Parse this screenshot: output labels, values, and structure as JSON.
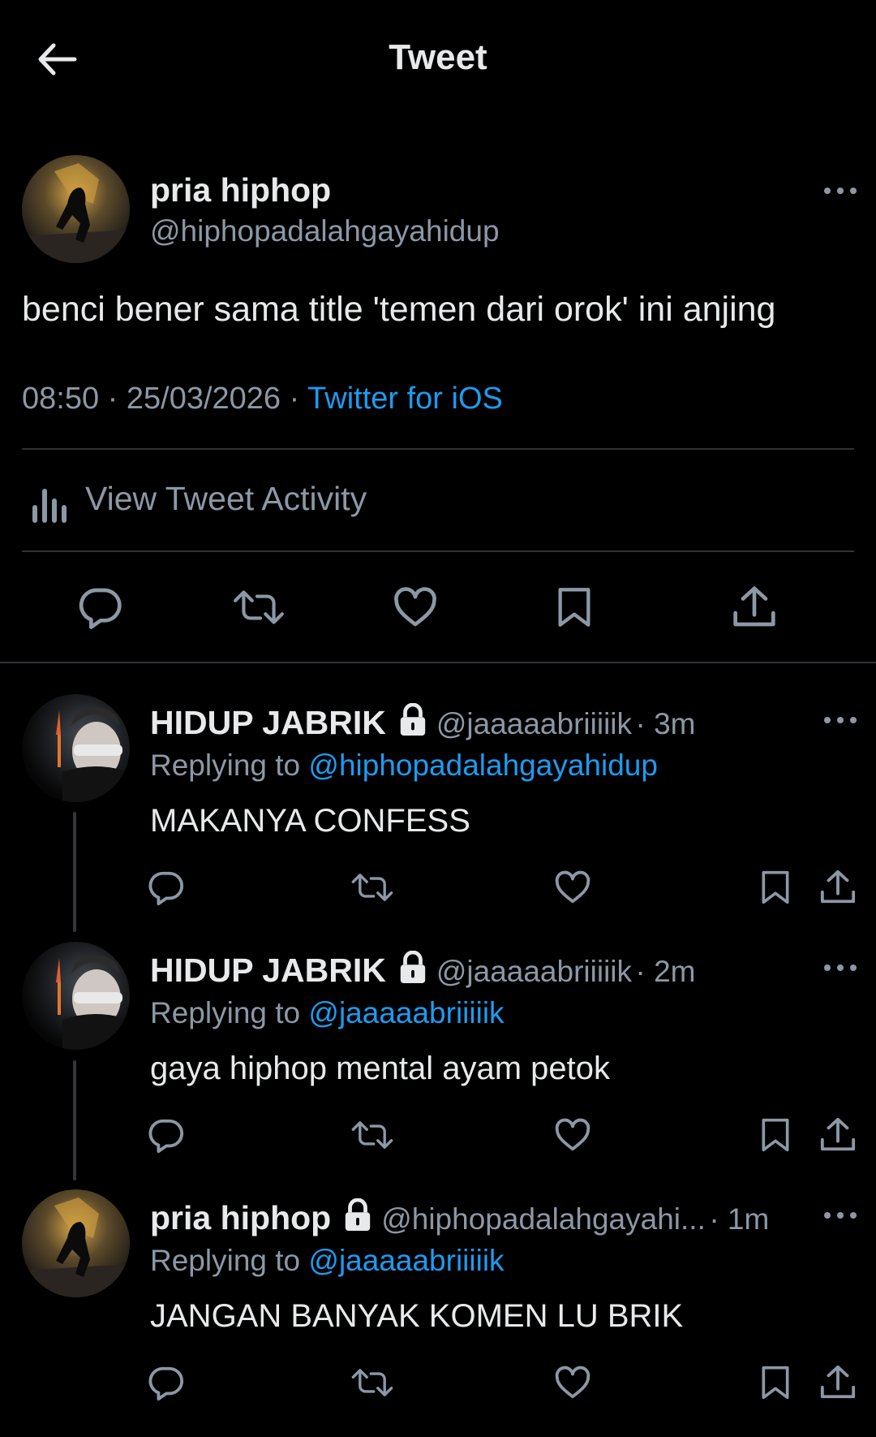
{
  "header": {
    "title": "Tweet"
  },
  "main_tweet": {
    "name": "pria hiphop",
    "handle": "@hiphopadalahgayahidup",
    "text": "benci bener sama title 'temen dari orok' ini anjing",
    "time": "08:50",
    "date": "25/03/2026",
    "source": "Twitter for iOS",
    "separator": "·",
    "activity_label": "View Tweet Activity"
  },
  "replies": [
    {
      "name": "HIDUP JABRIK",
      "handle": "@jaaaaabriiiiik",
      "age": "· 3m",
      "replying_prefix": "Replying to",
      "replying_to": "@hiphopadalahgayahidup",
      "text": "MAKANYA CONFESS"
    },
    {
      "name": "HIDUP JABRIK",
      "handle": "@jaaaaabriiiiik",
      "age": "· 2m",
      "replying_prefix": "Replying to",
      "replying_to": "@jaaaaabriiiiik",
      "text": "gaya hiphop mental ayam petok"
    },
    {
      "name": "pria hiphop",
      "handle": "@hiphopadalahgayahi...",
      "age": "· 1m",
      "replying_prefix": "Replying to",
      "replying_to": "@jaaaaabriiiiik",
      "text": "JANGAN BANYAK KOMEN LU BRIK"
    }
  ],
  "colors": {
    "background": "#000000",
    "text": "#e7e9ea",
    "muted": "#8b98a5",
    "link": "#1d9bf0",
    "divider": "#2f3336"
  },
  "icons": [
    "back-arrow-icon",
    "more-icon",
    "activity-chart-icon",
    "reply-icon",
    "retweet-icon",
    "like-icon",
    "bookmark-icon",
    "share-icon",
    "lock-icon"
  ]
}
